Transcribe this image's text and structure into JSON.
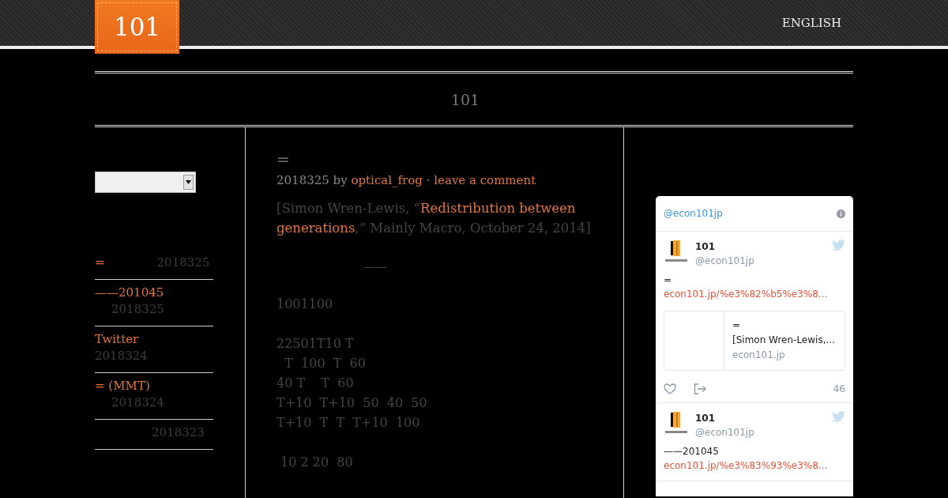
{
  "header": {
    "logo": "101",
    "nav": [
      {
        "label": "ENGLISH"
      }
    ]
  },
  "site_title": "101",
  "sidebar": {
    "recent_posts": [
      {
        "title": "=",
        "date": "2018325"
      },
      {
        "title": "——201045",
        "date": "2018325"
      },
      {
        "title": "Twitter",
        "date": "2018324"
      },
      {
        "title": "= (MMT)",
        "date": "2018324"
      },
      {
        "date": "2018323"
      }
    ]
  },
  "post": {
    "title": "=",
    "date": "2018325",
    "by": "by",
    "author": "optical_frog",
    "separator": "·",
    "comment_link": "leave a comment",
    "citation_before": "[Simon Wren-Lewis, “",
    "citation_link": [
      "Redistribution between",
      "generations"
    ],
    "citation_after": ",” Mainly Macro, October 24, 2014]",
    "divider": "——",
    "paragraphs": [
      [
        "1001100"
      ],
      [
        "22501T10 T",
        "  T  100  T  60",
        "40 T    T  60",
        "T+10  T+10  50  40  50",
        "T+10  T  T  T+10  100"
      ],
      [
        " 10 2 20  80"
      ]
    ]
  },
  "twitter": {
    "handle": "@econ101jp",
    "tweets": [
      {
        "name": "101",
        "handle": "@econ101jp",
        "text": "=",
        "link": "econ101.jp/%e3%82%b5%e3%8...",
        "card": {
          "title": "=",
          "description": "[Simon Wren-Lewis,...",
          "domain": "econ101.jp"
        },
        "count": "46"
      },
      {
        "name": "101",
        "handle": "@econ101jp",
        "text": "——201045",
        "link": "econ101.jp/%e3%83%93%e3%8..."
      }
    ]
  }
}
